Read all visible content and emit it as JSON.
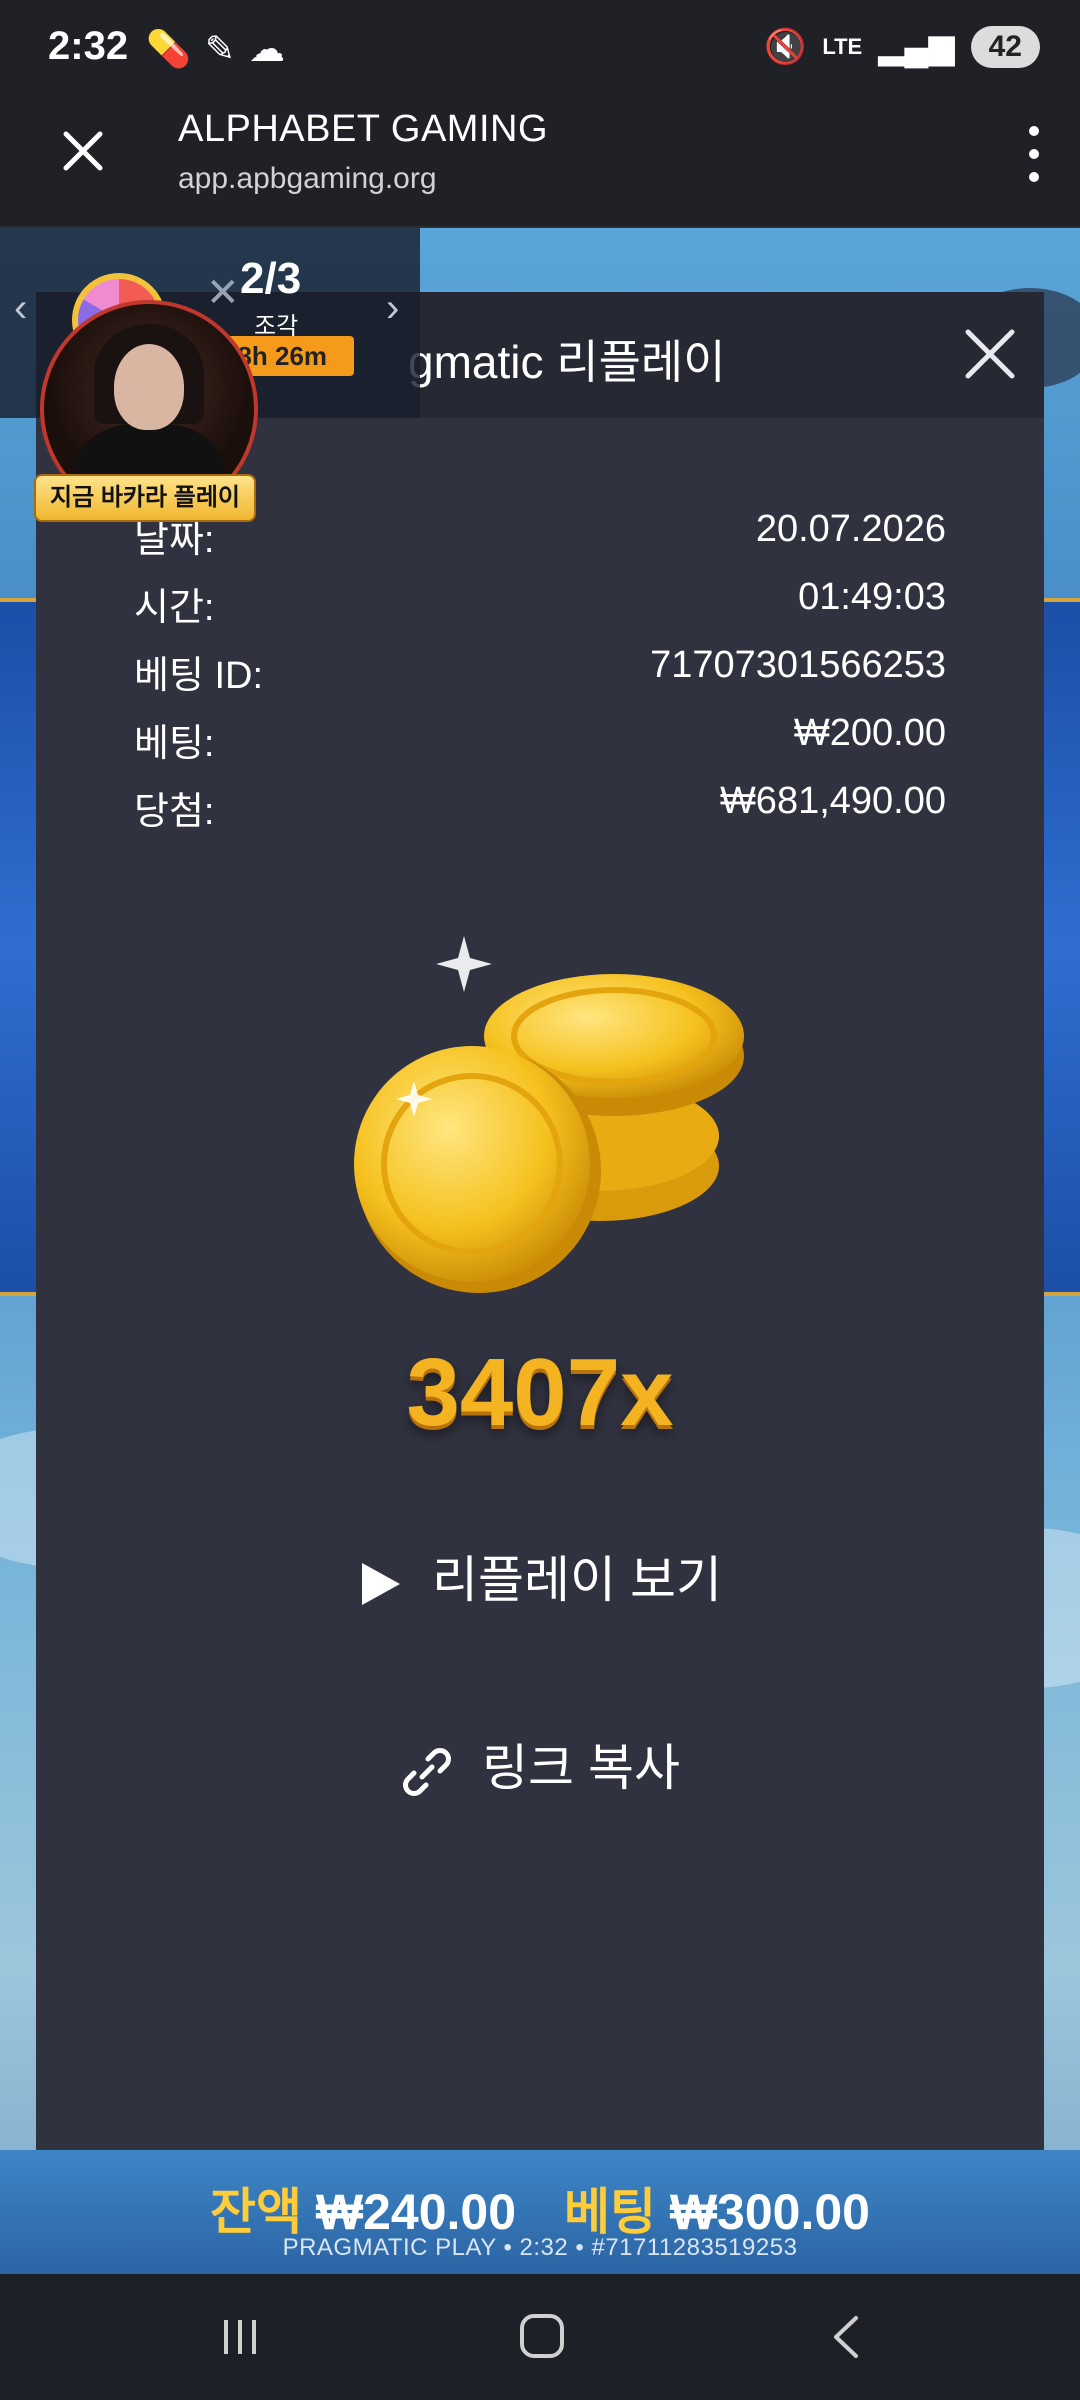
{
  "status_bar": {
    "time": "2:32",
    "battery": "42",
    "network": "LTE"
  },
  "browser": {
    "title": "ALPHABET GAMING",
    "url": "app.apbgaming.org"
  },
  "promo": {
    "count": "2/3",
    "subtitle": "조각",
    "timer": "18h 26m",
    "play_label": "지금 바카라 플레이"
  },
  "modal": {
    "title": "gmatic 리플레이",
    "details": [
      {
        "label": "날짜:",
        "value": "20.07.2026"
      },
      {
        "label": "시간:",
        "value": "01:49:03"
      },
      {
        "label": "베팅 ID:",
        "value": "71707301566253"
      },
      {
        "label": "베팅:",
        "value": "₩200.00"
      },
      {
        "label": "당첨:",
        "value": "₩681,490.00"
      }
    ],
    "multiplier": "3407x",
    "watch_replay": "리플레이 보기",
    "copy_link": "링크 복사"
  },
  "game_bar": {
    "balance_label": "잔액",
    "balance_value": "₩240.00",
    "bet_label": "베팅",
    "bet_value": "₩300.00",
    "footer": "PRAGMATIC PLAY • 2:32 • #71711283519253"
  },
  "colors": {
    "modal_bg": "#30323f",
    "accent_gold": "#f4b320",
    "timer_orange": "#f59a1a"
  },
  "icons": {
    "close": "close-icon",
    "menu": "more-vert-icon",
    "play": "play-icon",
    "link": "link-icon",
    "wheel": "prize-wheel-icon"
  }
}
